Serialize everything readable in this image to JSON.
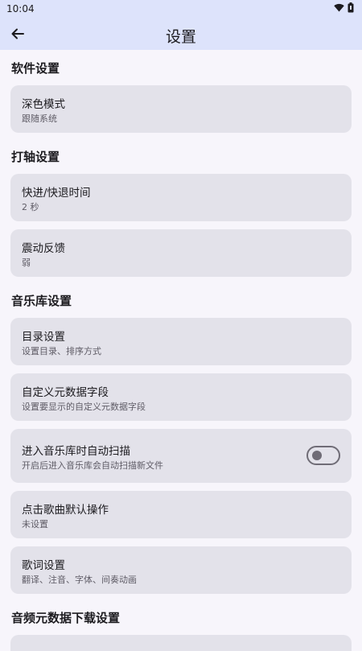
{
  "status": {
    "time": "10:04",
    "wifi_icon": "wifi-icon",
    "battery_icon": "battery-icon"
  },
  "appbar": {
    "title": "设置",
    "back_icon": "arrow-back-icon"
  },
  "sections": [
    {
      "title": "软件设置",
      "items": [
        {
          "label": "深色模式",
          "sub": "跟随系统"
        }
      ]
    },
    {
      "title": "打轴设置",
      "items": [
        {
          "label": "快进/快退时间",
          "sub": "2 秒"
        },
        {
          "label": "震动反馈",
          "sub": "弱"
        }
      ]
    },
    {
      "title": "音乐库设置",
      "items": [
        {
          "label": "目录设置",
          "sub": "设置目录、排序方式"
        },
        {
          "label": "自定义元数据字段",
          "sub": "设置要显示的自定义元数据字段"
        },
        {
          "label": "进入音乐库时自动扫描",
          "sub": "开启后进入音乐库会自动扫描新文件",
          "toggle": false
        },
        {
          "label": "点击歌曲默认操作",
          "sub": "未设置"
        },
        {
          "label": "歌词设置",
          "sub": "翻译、注音、字体、间奏动画"
        }
      ]
    },
    {
      "title": "音频元数据下载设置",
      "items": []
    }
  ],
  "colors": {
    "appbar_bg": "#dde3fb",
    "page_bg": "#f7f5fb",
    "card_bg": "#e3e2ea",
    "text_primary": "#1c1b1f",
    "text_secondary": "#5f5c66"
  }
}
